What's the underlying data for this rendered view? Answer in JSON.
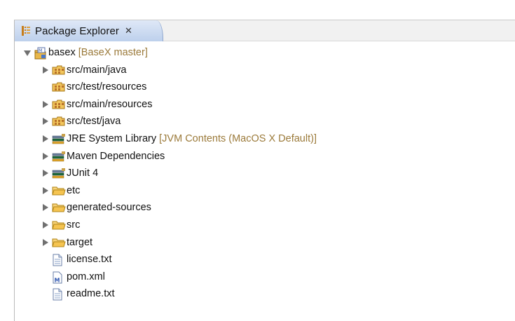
{
  "view": {
    "tab_label": "Package Explorer",
    "close_glyph": "✕"
  },
  "tree": [
    {
      "label": "basex",
      "suffix": "[BaseX master]",
      "icon": "maven-project-icon",
      "level": 0,
      "expander": "expanded"
    },
    {
      "label": "src/main/java",
      "suffix": "",
      "icon": "source-folder-icon",
      "level": 1,
      "expander": "collapsed"
    },
    {
      "label": "src/test/resources",
      "suffix": "",
      "icon": "source-folder-icon",
      "level": 1,
      "expander": "none"
    },
    {
      "label": "src/main/resources",
      "suffix": "",
      "icon": "source-folder-icon",
      "level": 1,
      "expander": "collapsed"
    },
    {
      "label": "src/test/java",
      "suffix": "",
      "icon": "source-folder-icon",
      "level": 1,
      "expander": "collapsed"
    },
    {
      "label": "JRE System Library",
      "suffix": "[JVM Contents (MacOS X Default)]",
      "icon": "library-icon",
      "level": 1,
      "expander": "collapsed"
    },
    {
      "label": "Maven Dependencies",
      "suffix": "",
      "icon": "library-icon",
      "level": 1,
      "expander": "collapsed"
    },
    {
      "label": "JUnit 4",
      "suffix": "",
      "icon": "library-icon",
      "level": 1,
      "expander": "collapsed"
    },
    {
      "label": "etc",
      "suffix": "",
      "icon": "folder-icon",
      "level": 1,
      "expander": "collapsed"
    },
    {
      "label": "generated-sources",
      "suffix": "",
      "icon": "folder-icon",
      "level": 1,
      "expander": "collapsed"
    },
    {
      "label": "src",
      "suffix": "",
      "icon": "folder-icon",
      "level": 1,
      "expander": "collapsed"
    },
    {
      "label": "target",
      "suffix": "",
      "icon": "folder-icon",
      "level": 1,
      "expander": "collapsed"
    },
    {
      "label": "license.txt",
      "suffix": "",
      "icon": "text-file-icon",
      "level": 1,
      "expander": "none"
    },
    {
      "label": "pom.xml",
      "suffix": "",
      "icon": "maven-pom-icon",
      "level": 1,
      "expander": "none"
    },
    {
      "label": "readme.txt",
      "suffix": "",
      "icon": "text-file-icon",
      "level": 1,
      "expander": "none"
    }
  ],
  "colors": {
    "decoration": "#9b7a3a",
    "tab_top": "#dfe8f7",
    "tab_bottom": "#bdd0ec"
  }
}
